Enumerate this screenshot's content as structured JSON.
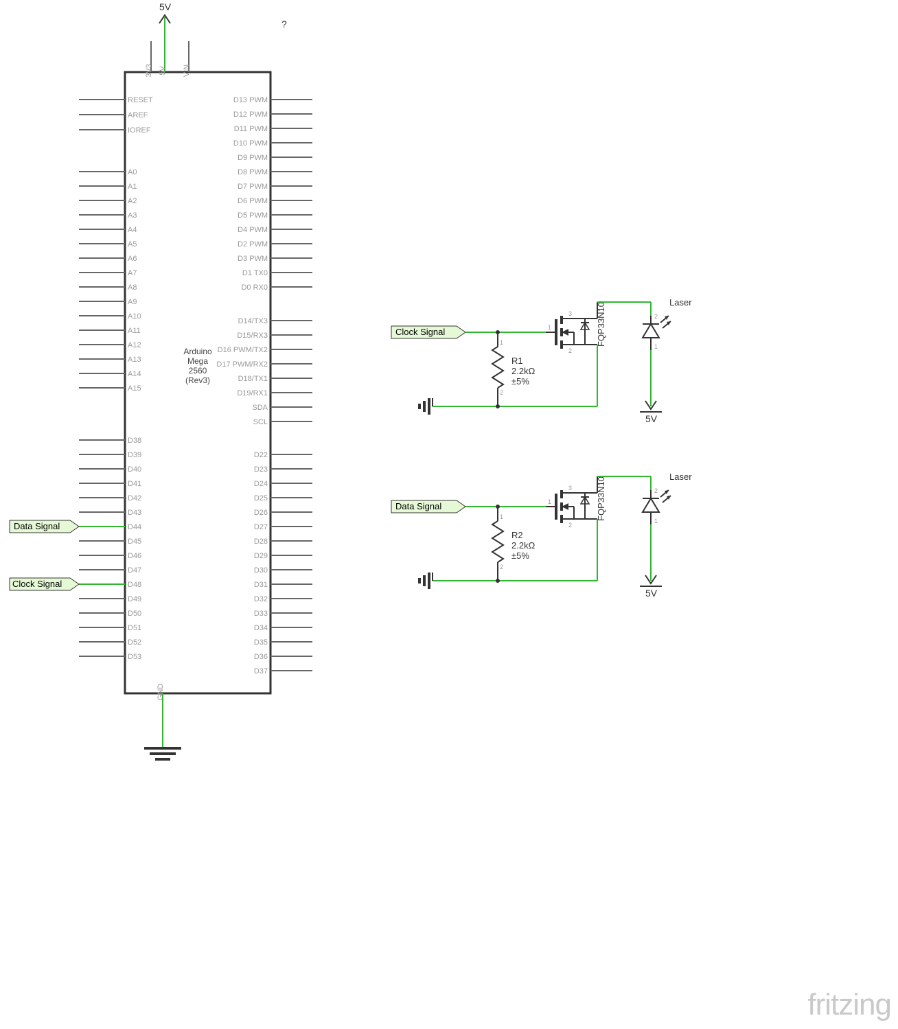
{
  "board": {
    "name_line1": "Arduino",
    "name_line2": "Mega",
    "name_line3": "2560",
    "name_line4": "(Rev3)"
  },
  "top_pins": {
    "p3v3": "3V3",
    "p5v": "5V",
    "vin": "VIN"
  },
  "top_voltage_label": "5V",
  "question_mark": "?",
  "left_col_upper": [
    "RESET",
    "AREF",
    "IOREF"
  ],
  "left_col_analog": [
    "A0",
    "A1",
    "A2",
    "A3",
    "A4",
    "A5",
    "A6",
    "A7",
    "A8",
    "A9",
    "A10",
    "A11",
    "A12",
    "A13",
    "A14",
    "A15"
  ],
  "left_col_digital": [
    "D38",
    "D39",
    "D40",
    "D41",
    "D42",
    "D43",
    "D44",
    "D45",
    "D46",
    "D47",
    "D48",
    "D49",
    "D50",
    "D51",
    "D52",
    "D53"
  ],
  "right_col_upper": [
    "D13 PWM",
    "D12 PWM",
    "D11 PWM",
    "D10 PWM",
    "D9 PWM",
    "D8 PWM",
    "D7 PWM",
    "D6 PWM",
    "D5 PWM",
    "D4 PWM",
    "D2 PWM",
    "D3 PWM",
    "D1 TX0",
    "D0 RX0"
  ],
  "right_col_mid": [
    "D14/TX3",
    "D15/RX3",
    "D16 PWM/TX2",
    "D17 PWM/RX2",
    "D18/TX1",
    "D19/RX1",
    "SDA",
    "SCL"
  ],
  "right_col_lower": [
    "D22",
    "D23",
    "D24",
    "D25",
    "D26",
    "D27",
    "D28",
    "D29",
    "D30",
    "D31",
    "D32",
    "D33",
    "D34",
    "D35",
    "D36",
    "D37"
  ],
  "gnd_label": "GND",
  "net_labels": {
    "data_signal": "Data Signal",
    "clock_signal": "Clock Signal"
  },
  "driver1": {
    "signal": "Clock Signal",
    "resistor_name": "R1",
    "resistor_value": "2.2kΩ",
    "resistor_tol": "±5%",
    "mosfet": "FQP33N10",
    "load": "Laser",
    "supply": "5V"
  },
  "driver2": {
    "signal": "Data Signal",
    "resistor_name": "R2",
    "resistor_value": "2.2kΩ",
    "resistor_tol": "±5%",
    "mosfet": "FQP33N10",
    "load": "Laser",
    "supply": "5V"
  },
  "watermark": "fritzing"
}
